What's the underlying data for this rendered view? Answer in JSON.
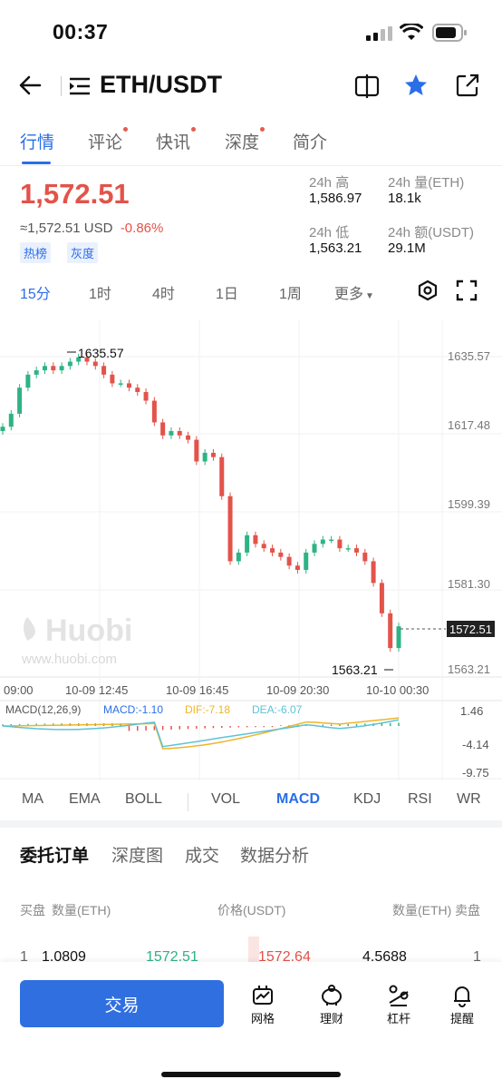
{
  "status_bar": {
    "time": "00:37"
  },
  "header": {
    "pair": "ETH/USDT"
  },
  "tabs": [
    {
      "label": "行情",
      "active": true,
      "dot": false
    },
    {
      "label": "评论",
      "active": false,
      "dot": true
    },
    {
      "label": "快讯",
      "active": false,
      "dot": true
    },
    {
      "label": "深度",
      "active": false,
      "dot": true
    },
    {
      "label": "简介",
      "active": false,
      "dot": false
    }
  ],
  "ticker": {
    "price": "1,572.51",
    "usd": "≈1,572.51 USD",
    "change": "-0.86%",
    "tags": [
      "热榜",
      "灰度"
    ],
    "high_label": "24h 高",
    "high": "1,586.97",
    "low_label": "24h 低",
    "low": "1,563.21",
    "vol_label": "24h 量(ETH)",
    "vol": "18.1k",
    "amt_label": "24h 额(USDT)",
    "amt": "29.1M"
  },
  "intervals": [
    "15分",
    "1时",
    "4时",
    "1日",
    "1周",
    "更多"
  ],
  "chart": {
    "price_ticks": [
      "1635.57",
      "1617.48",
      "1599.39",
      "1581.30",
      "1563.21"
    ],
    "current_price_label": "1572.51",
    "max_label": "1635.57",
    "min_label": "1563.21",
    "time_labels": [
      "09:00",
      "10-09 12:45",
      "10-09 16:45",
      "10-09 20:30",
      "10-10 00:30"
    ],
    "watermark": "Huobi",
    "watermark_url": "www.huobi.com",
    "macd_header": {
      "name": "MACD(12,26,9)",
      "macd": "MACD:-1.10",
      "dif": "DIF:-7.18",
      "dea": "DEA:-6.07"
    },
    "macd_ticks": [
      "1.46",
      "-4.14",
      "-9.75"
    ],
    "colors": {
      "up": "#2eb384",
      "down": "#e3534a",
      "dif": "#f0b429",
      "dea": "#5cc3d8",
      "accent": "#2a6ee8"
    }
  },
  "chart_data": {
    "type": "candlestick",
    "pair": "ETH/USDT",
    "interval": "15分",
    "ylim": [
      1563.21,
      1635.57
    ],
    "candles_close_approx": [
      1619,
      1622,
      1628,
      1631,
      1632,
      1633,
      1632,
      1633,
      1634,
      1635,
      1634,
      1633,
      1631,
      1629,
      1629,
      1628,
      1627,
      1625,
      1620,
      1617,
      1618,
      1617,
      1616,
      1611,
      1613,
      1612,
      1603,
      1588,
      1590,
      1594,
      1592,
      1591,
      1590,
      1589,
      1587,
      1586,
      1590,
      1592,
      1593,
      1593,
      1591,
      1591,
      1590,
      1588,
      1583,
      1576,
      1568,
      1573
    ]
  },
  "indicators": [
    "MA",
    "EMA",
    "BOLL",
    "VOL",
    "MACD",
    "KDJ",
    "RSI",
    "WR"
  ],
  "order_tabs": [
    "委托订单",
    "深度图",
    "成交",
    "数据分析"
  ],
  "orderbook": {
    "headers": {
      "buy": "买盘",
      "buy_qty": "数量(ETH)",
      "price": "价格(USDT)",
      "sell_qty": "数量(ETH)",
      "sell": "卖盘"
    },
    "row": {
      "idx_l": "1",
      "bid_qty": "1.0809",
      "bid": "1572.51",
      "ask": "1572.64",
      "ask_qty": "4.5688",
      "idx_r": "1"
    }
  },
  "bottom": {
    "trade": "交易",
    "items": [
      {
        "label": "网格",
        "icon": "grid-bot-icon"
      },
      {
        "label": "理财",
        "icon": "piggy-bank-icon"
      },
      {
        "label": "杠杆",
        "icon": "leverage-icon"
      },
      {
        "label": "提醒",
        "icon": "bell-icon"
      }
    ]
  }
}
